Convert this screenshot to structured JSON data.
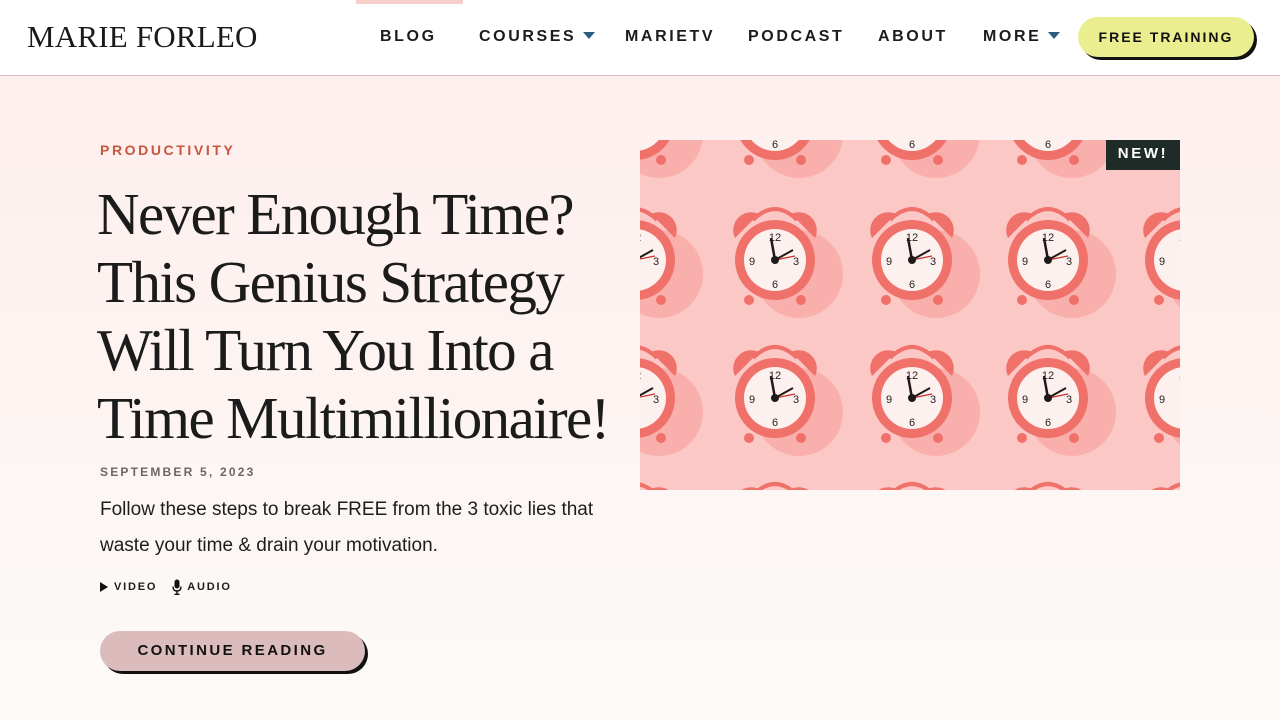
{
  "header": {
    "logo": "MARIE FORLEO",
    "nav": [
      {
        "label": "BLOG",
        "active": true
      },
      {
        "label": "COURSES",
        "dropdown": true
      },
      {
        "label": "MARIETV"
      },
      {
        "label": "PODCAST"
      },
      {
        "label": "ABOUT"
      },
      {
        "label": "MORE",
        "dropdown": true
      }
    ],
    "cta_label": "FREE TRAINING"
  },
  "post": {
    "category": "PRODUCTIVITY",
    "title_lines": [
      "Never Enough Time?",
      "This Genius Strategy",
      "Will Turn You Into a",
      "Time Multimillionaire!"
    ],
    "date": "SEPTEMBER 5, 2023",
    "excerpt": "Follow these steps to break FREE from the 3 toxic lies that waste your time & drain your motivation.",
    "media": [
      {
        "label": "VIDEO",
        "icon": "play-icon"
      },
      {
        "label": "AUDIO",
        "icon": "microphone-icon"
      }
    ],
    "continue_label": "CONTINUE READING",
    "badge": "NEW!",
    "image_subject": "alarm-clocks-pattern"
  },
  "colors": {
    "accent_category": "#c9553d",
    "cta_training_bg": "#eaee8e",
    "cta_continue_bg": "#dcbbbd",
    "image_bg": "#fcc8c6",
    "clock_body": "#f0706a",
    "nav_caret": "#2a5d80",
    "badge_bg": "#1f2b27"
  }
}
